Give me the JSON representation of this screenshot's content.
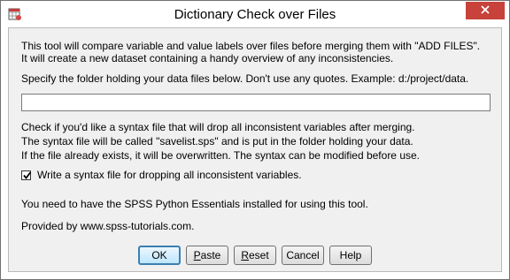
{
  "window": {
    "title": "Dictionary Check over Files",
    "app_icon": "spss-data-icon",
    "close_icon": "close-icon"
  },
  "intro": {
    "line1": "This tool will compare variable and value labels over files before merging them with \"ADD FILES\".",
    "line2": "It will create a new dataset containing a handy overview of any inconsistencies."
  },
  "folder": {
    "label": "Specify the folder holding your data files below. Don't use any quotes. Example: d:/project/data.",
    "value": "",
    "placeholder": ""
  },
  "syntax_info": {
    "line1": "Check if you'd like a syntax file that will drop all inconsistent variables after merging.",
    "line2": "The syntax file will be called \"savelist.sps\" and is put in the folder holding your data.",
    "line3": "If the file already exists, it will be overwritten. The syntax can be modified before use."
  },
  "checkbox": {
    "label": "Write a syntax file for dropping all inconsistent variables.",
    "checked": true
  },
  "requirement": "You need to have the SPSS Python Essentials installed for using this tool.",
  "provided_by": "Provided by www.spss-tutorials.com.",
  "buttons": {
    "ok": "OK",
    "paste_first": "P",
    "paste_rest": "aste",
    "reset_first": "R",
    "reset_rest": "eset",
    "cancel": "Cancel",
    "help": "Help"
  },
  "colors": {
    "close_button": "#c7423a",
    "default_button_border": "#3c7fb1"
  }
}
